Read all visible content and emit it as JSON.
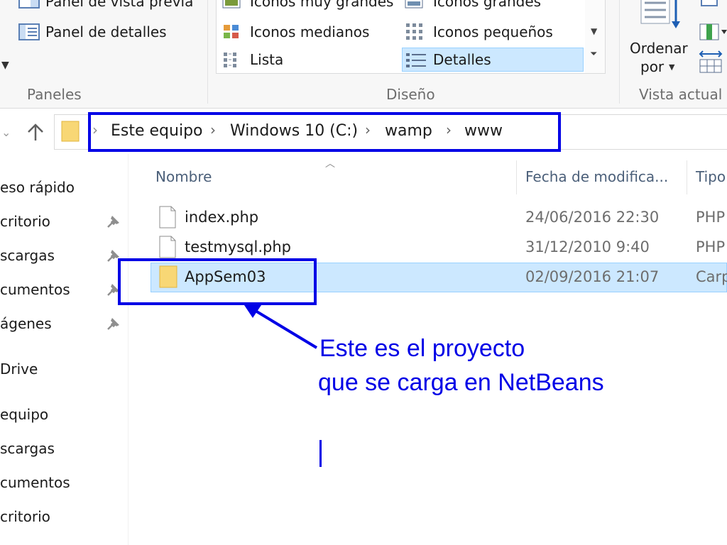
{
  "ribbon": {
    "panes_group": {
      "label": "Paneles",
      "preview_pane": "Panel de vista previa",
      "details_pane": "Panel de detalles"
    },
    "layout_group": {
      "label": "Diseño",
      "items": {
        "extra_large_icons": "Iconos muy grandes",
        "large_icons": "Iconos grandes",
        "medium_icons": "Iconos medianos",
        "small_icons": "Iconos pequeños",
        "list": "Lista",
        "details": "Detalles"
      },
      "selected": "Detalles"
    },
    "current_view_group": {
      "label": "Vista actual",
      "sort_by_line1": "Ordenar",
      "sort_by_line2": "por"
    }
  },
  "address_bar": {
    "breadcrumbs": [
      "Este equipo",
      "Windows 10 (C:)",
      "wamp",
      "www"
    ]
  },
  "nav_pane": {
    "items": [
      {
        "label": "eso rápido",
        "pinned": false
      },
      {
        "label": "critorio",
        "pinned": true
      },
      {
        "label": "scargas",
        "pinned": true
      },
      {
        "label": "cumentos",
        "pinned": true
      },
      {
        "label": "ágenes",
        "pinned": true
      },
      {
        "label": "Drive",
        "pinned": false
      },
      {
        "label": "equipo",
        "pinned": false
      },
      {
        "label": "scargas",
        "pinned": false
      },
      {
        "label": "cumentos",
        "pinned": false
      },
      {
        "label": "critorio",
        "pinned": false
      }
    ]
  },
  "file_list": {
    "columns": {
      "name": "Nombre",
      "date": "Fecha de modifica...",
      "type": "Tipo"
    },
    "rows": [
      {
        "name": "index.php",
        "date": "24/06/2016 22:30",
        "type": "PHP",
        "kind": "file"
      },
      {
        "name": "testmysql.php",
        "date": "31/12/2010 9:40",
        "type": "PHP",
        "kind": "file"
      },
      {
        "name": "AppSem03",
        "date": "02/09/2016 21:07",
        "type": "Carp",
        "kind": "folder",
        "selected": true
      }
    ]
  },
  "annotation": {
    "line1": "Este es el proyecto",
    "line2": "que se carga en NetBeans",
    "color": "#0000e6"
  },
  "colors": {
    "selection_bg": "#cce8ff",
    "selection_border": "#99d1ff",
    "folder": "#f8d775",
    "annotation": "#0000e6"
  }
}
